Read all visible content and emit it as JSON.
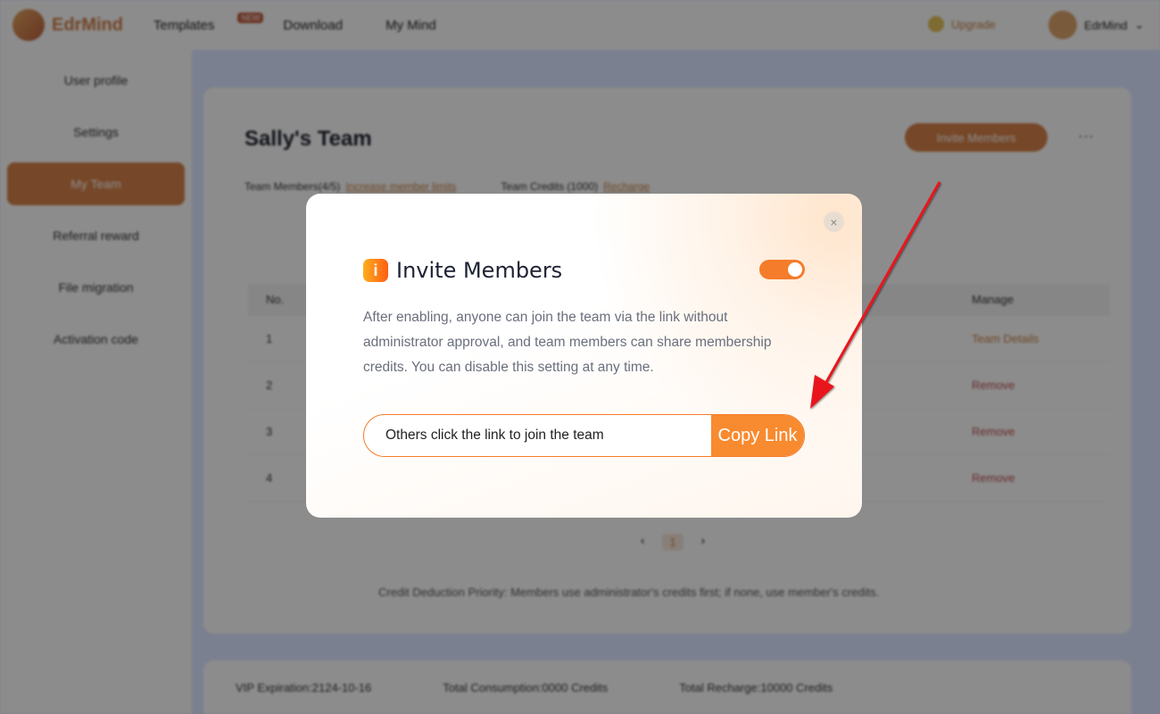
{
  "topbar": {
    "brand": "EdrMind",
    "nav": [
      {
        "label": "Templates",
        "badge": "NEW"
      },
      {
        "label": "Download"
      },
      {
        "label": "My Mind"
      }
    ],
    "upgrade": "Upgrade",
    "user": "EdrMind"
  },
  "sidebar": {
    "items": [
      {
        "label": "User profile"
      },
      {
        "label": "Settings"
      },
      {
        "label": "My Team",
        "active": true
      },
      {
        "label": "Referral reward"
      },
      {
        "label": "File migration"
      },
      {
        "label": "Activation code"
      }
    ]
  },
  "main": {
    "title": "Sally's Team",
    "invite_button": "Invite Members",
    "more": "···",
    "members_label": "Team Members(4/5)",
    "members_link": "Increase member limits",
    "credits_label": "Team Credits (1000)",
    "credits_link": "Recharge",
    "table": {
      "headers": [
        "No.",
        "",
        "Manage"
      ],
      "rows": [
        [
          "1",
          "",
          "Team Details"
        ],
        [
          "2",
          "",
          "Remove"
        ],
        [
          "3",
          "",
          "Remove"
        ],
        [
          "4",
          "",
          "Remove"
        ]
      ]
    },
    "page": "1",
    "note": "Credit Deduction Priority: Members use administrator's credits first; if none, use member's credits."
  },
  "footer": {
    "vip": "VIP Expiration:2124-10-16",
    "consumption": "Total Consumption:0000 Credits",
    "recharge": "Total Recharge:10000 Credits"
  },
  "modal": {
    "title": "Invite Members",
    "toggle_on": true,
    "description": "After enabling, anyone can join the team via the link without administrator approval, and team members can share membership credits. You can disable this setting at any time.",
    "link_text": "Others click the link to join the team",
    "copy_button": "Copy Link",
    "close": "×",
    "accent": "#f57c2a"
  }
}
